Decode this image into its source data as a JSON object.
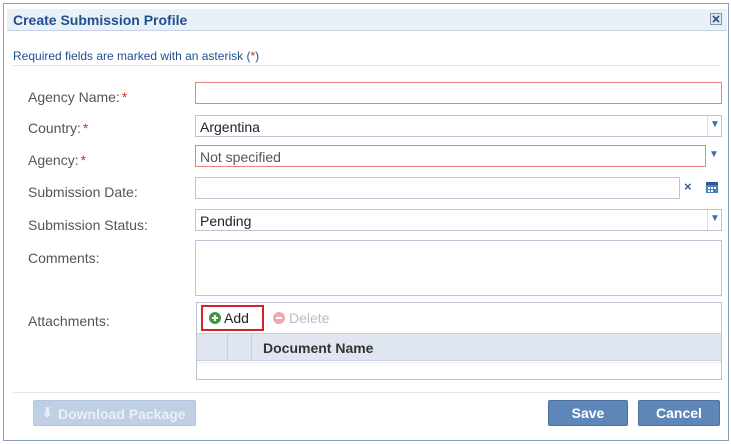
{
  "dialog": {
    "title": "Create Submission Profile",
    "required_note": "Required fields are marked with an asterisk (",
    "required_star": "*",
    "required_close": ")"
  },
  "form": {
    "agency_name": {
      "label": "Agency Name:",
      "required": "*",
      "value": ""
    },
    "country": {
      "label": "Country:",
      "required": "*",
      "value": "Argentina"
    },
    "agency": {
      "label": "Agency:",
      "required": "*",
      "value": "Not specified"
    },
    "submission_date": {
      "label": "Submission Date:",
      "value": ""
    },
    "submission_status": {
      "label": "Submission Status:",
      "value": "Pending"
    },
    "comments": {
      "label": "Comments:",
      "value": ""
    }
  },
  "attachments": {
    "label": "Attachments:",
    "add_label": "Add",
    "delete_label": "Delete",
    "columns": [
      "Document Name"
    ]
  },
  "buttons": {
    "download": "Download Package",
    "save": "Save",
    "cancel": "Cancel"
  },
  "colors": {
    "accent": "#5f86b8",
    "title": "#1e4f8e",
    "error_border": "#e6857c",
    "required_star": "#d82c2c",
    "add_icon": "#3e9a3e",
    "delete_icon": "#f0a9a9"
  }
}
